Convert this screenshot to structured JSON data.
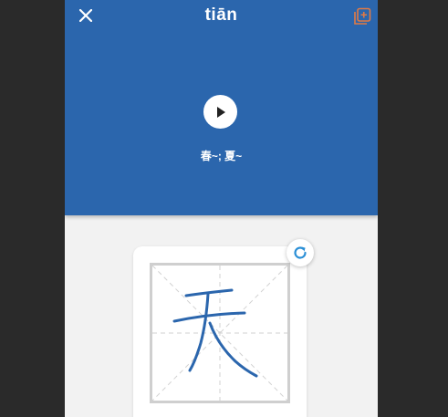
{
  "header": {
    "title": "tiān",
    "close_icon": "close-icon",
    "add_icon": "add-to-collection-icon",
    "play_icon": "play-icon",
    "example": "春~; 夏~",
    "background_color": "#2b66ad"
  },
  "practice": {
    "refresh_icon": "refresh-icon",
    "stroke_color": "#2b66ad",
    "grid_line_color": "#c8c8c8"
  }
}
